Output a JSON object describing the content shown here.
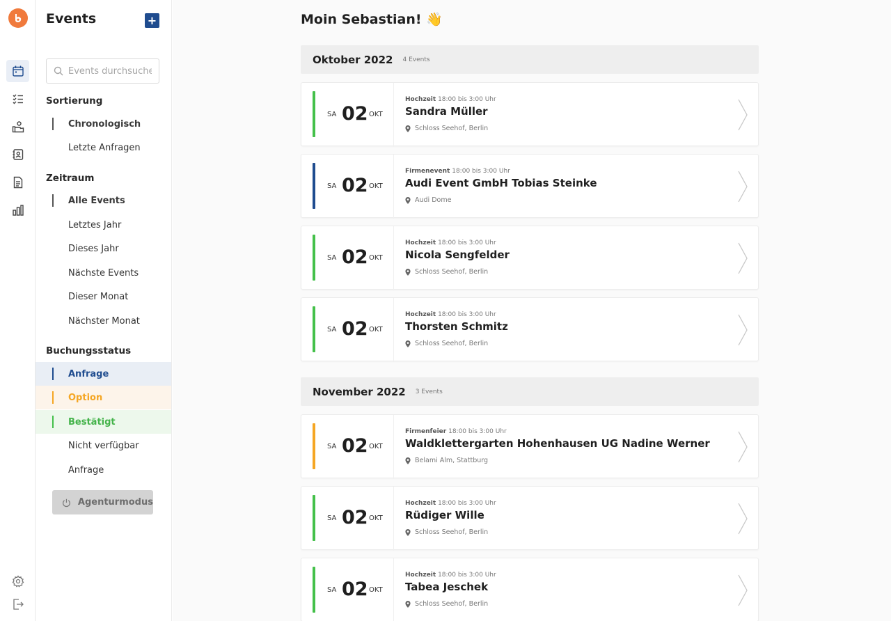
{
  "rail": {
    "logo": "b",
    "items": [
      {
        "icon": "calendar-icon",
        "active": true
      },
      {
        "icon": "checklist-icon",
        "active": false
      },
      {
        "icon": "hand-coins-icon",
        "active": false
      },
      {
        "icon": "contacts-book-icon",
        "active": false
      },
      {
        "icon": "document-icon",
        "active": false
      },
      {
        "icon": "bar-chart-icon",
        "active": false
      }
    ],
    "bottom": [
      "settings-icon",
      "logout-icon"
    ]
  },
  "sidebar": {
    "title": "Events",
    "add_label": "+",
    "search_placeholder": "Events durchsuchen",
    "sort_label": "Sortierung",
    "sort_items": [
      "Chronologisch",
      "Letzte Anfragen"
    ],
    "range_label": "Zeitraum",
    "range_items": [
      "Alle Events",
      "Letztes Jahr",
      "Dieses Jahr",
      "Nächste Events",
      "Dieser Monat",
      "Nächster Monat"
    ],
    "status_label": "Buchungsstatus",
    "status_items": [
      "Anfrage",
      "Option",
      "Bestätigt",
      "Nicht verfügbar",
      "Anfrage"
    ],
    "agent_button": "Agenturmodus"
  },
  "main": {
    "greeting": "Moin Sebastian! 👋",
    "months": [
      {
        "title": "Oktober 2022",
        "count": "4 Events"
      },
      {
        "title": "November 2022",
        "count": "3 Events"
      }
    ],
    "events": [
      {
        "color": "#44c04a",
        "dow": "SA",
        "day": "02",
        "month": "OKT",
        "type": "Hochzeit",
        "time": "18:00 bis 3:00 Uhr",
        "name": "Sandra Müller",
        "location": "Schloss Seehof, Berlin"
      },
      {
        "color": "#1f4c8f",
        "dow": "SA",
        "day": "02",
        "month": "OKT",
        "type": "Firmenevent",
        "time": "18:00 bis 3:00 Uhr",
        "name": "Audi Event GmbH Tobias Steinke",
        "location": "Audi Dome"
      },
      {
        "color": "#44c04a",
        "dow": "SA",
        "day": "02",
        "month": "OKT",
        "type": "Hochzeit",
        "time": "18:00 bis 3:00 Uhr",
        "name": "Nicola Sengfelder",
        "location": "Schloss Seehof, Berlin"
      },
      {
        "color": "#44c04a",
        "dow": "SA",
        "day": "02",
        "month": "OKT",
        "type": "Hochzeit",
        "time": "18:00 bis 3:00 Uhr",
        "name": "Thorsten Schmitz",
        "location": "Schloss Seehof, Berlin"
      },
      {
        "color": "#f5a623",
        "dow": "SA",
        "day": "02",
        "month": "OKT",
        "type": "Firmenfeier",
        "time": "18:00 bis 3:00 Uhr",
        "name": "Waldklettergarten Hohenhausen UG Nadine Werner",
        "location": "Belami Alm, Stattburg"
      },
      {
        "color": "#44c04a",
        "dow": "SA",
        "day": "02",
        "month": "OKT",
        "type": "Hochzeit",
        "time": "18:00 bis 3:00 Uhr",
        "name": "Rüdiger Wille",
        "location": "Schloss Seehof, Berlin"
      },
      {
        "color": "#44c04a",
        "dow": "SA",
        "day": "02",
        "month": "OKT",
        "type": "Hochzeit",
        "time": "18:00 bis 3:00 Uhr",
        "name": "Tabea Jeschek",
        "location": "Schloss Seehof, Berlin"
      }
    ]
  }
}
